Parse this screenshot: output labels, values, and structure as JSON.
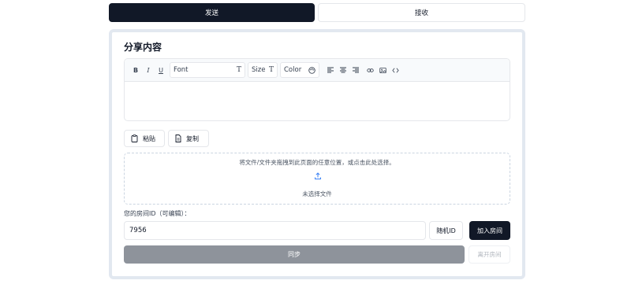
{
  "tabs": {
    "send": "发送",
    "receive": "接收"
  },
  "share": {
    "title": "分享内容",
    "toolbar": {
      "bold": "B",
      "italic": "I",
      "underline": "U",
      "font_label": "Font",
      "size_label": "Size",
      "color_label": "Color"
    },
    "paste_label": "粘贴",
    "copy_label": "复制"
  },
  "dropzone": {
    "hint": "将文件/文件夹拖拽到此页面的任意位置，或点击此处选择。",
    "status": "未选择文件"
  },
  "room": {
    "label": "您的房间ID（可编辑）：",
    "id_value": "7956",
    "random_label": "随机ID",
    "join_label": "加入房间"
  },
  "actions": {
    "sync_label": "同步",
    "leave_label": "离开房间"
  },
  "colors": {
    "primary": "#111827",
    "disabled": "#8e939b",
    "border": "#e2e8f0"
  }
}
